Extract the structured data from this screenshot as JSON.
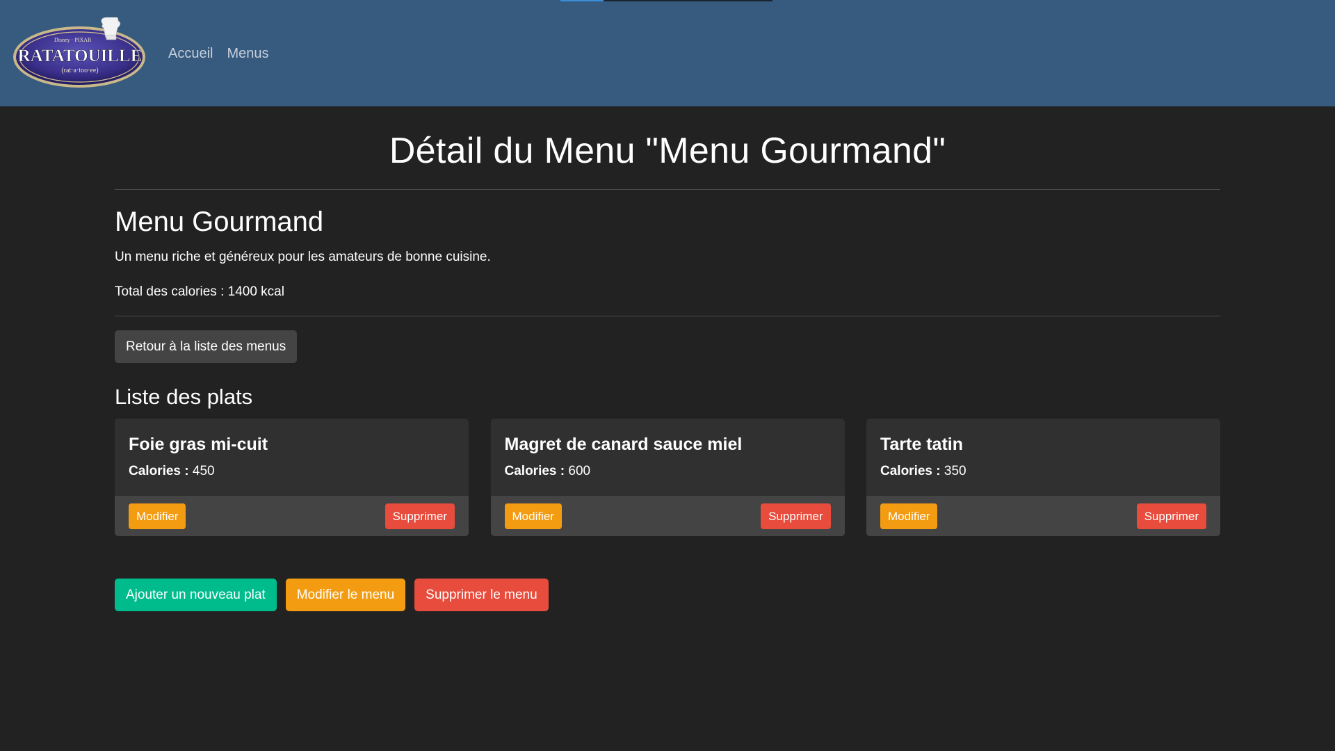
{
  "navbar": {
    "logo": {
      "studio": "Disney · PIXAR",
      "title": "RATATOUILLE",
      "tagline": "(rat·a·too·ee)"
    },
    "links": [
      {
        "label": "Accueil"
      },
      {
        "label": "Menus"
      }
    ]
  },
  "page": {
    "title": "Détail du Menu \"Menu Gourmand\""
  },
  "menu": {
    "name": "Menu Gourmand",
    "description": "Un menu riche et généreux pour les amateurs de bonne cuisine.",
    "calories_label": "Total des calories : 1400 kcal",
    "back_button": "Retour à la liste des menus"
  },
  "dishes": {
    "section_title": "Liste des plats",
    "calories_label": "Calories :",
    "edit_label": "Modifier",
    "delete_label": "Supprimer",
    "items": [
      {
        "name": "Foie gras mi-cuit",
        "calories": "450"
      },
      {
        "name": "Magret de canard sauce miel",
        "calories": "600"
      },
      {
        "name": "Tarte tatin",
        "calories": "350"
      }
    ]
  },
  "actions": {
    "add_dish": "Ajouter un nouveau plat",
    "edit_menu": "Modifier le menu",
    "delete_menu": "Supprimer le menu"
  },
  "colors": {
    "navbar": "#375a7f",
    "background": "#222222",
    "card": "#303030",
    "warning": "#f39c12",
    "danger": "#e74c3c",
    "success": "#00bc8c"
  }
}
